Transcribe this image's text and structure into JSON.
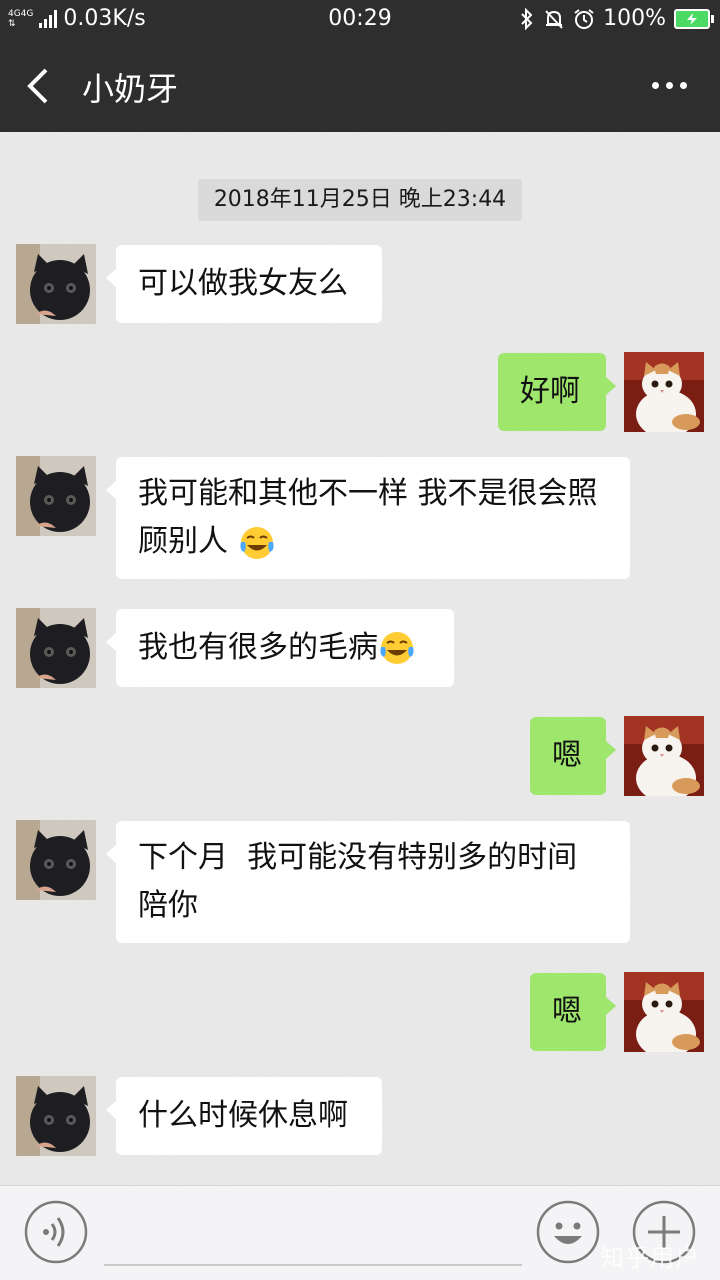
{
  "status_bar": {
    "network_tags": [
      "4G",
      "4G"
    ],
    "speed": "0.03K/s",
    "time": "00:29",
    "battery": "100%",
    "icons": [
      "bluetooth-icon",
      "bell-mute-icon",
      "alarm-icon",
      "battery-icon"
    ]
  },
  "header": {
    "title": "小奶牙",
    "icons": [
      "back-arrow-icon",
      "more-dots-icon"
    ],
    "bar_color": "#2e2e2e"
  },
  "chat": {
    "timestamp": "2018年11月25日 晚上23:44",
    "messages": [
      {
        "from": "them",
        "avatar": "black-cat-avatar",
        "lines": [
          "可以做我女友么"
        ]
      },
      {
        "from": "me",
        "avatar": "white-cat-avatar",
        "lines": [
          "好啊"
        ]
      },
      {
        "from": "them",
        "avatar": "black-cat-avatar",
        "lines": [
          "我可能和其他不一样 我不是很会照",
          "顾别人"
        ],
        "emoji": "tears-of-joy-emoji"
      },
      {
        "from": "them",
        "avatar": "black-cat-avatar",
        "lines": [
          "我也有很多的毛病"
        ],
        "emoji": "tears-of-joy-emoji"
      },
      {
        "from": "me",
        "avatar": "white-cat-avatar",
        "lines": [
          "嗯"
        ]
      },
      {
        "from": "them",
        "avatar": "black-cat-avatar",
        "lines": [
          "下个月  我可能没有特别多的时间",
          "陪你"
        ]
      },
      {
        "from": "me",
        "avatar": "white-cat-avatar",
        "lines": [
          "嗯"
        ]
      },
      {
        "from": "them",
        "avatar": "black-cat-avatar",
        "lines": [
          "什么时候休息啊"
        ]
      }
    ],
    "bubble_colors": {
      "incoming": "#ffffff",
      "outgoing": "#9ee66c"
    }
  },
  "input_bar": {
    "icons": [
      "voice-icon",
      "emoji-icon",
      "plus-icon"
    ]
  },
  "watermark": "知乎用户"
}
